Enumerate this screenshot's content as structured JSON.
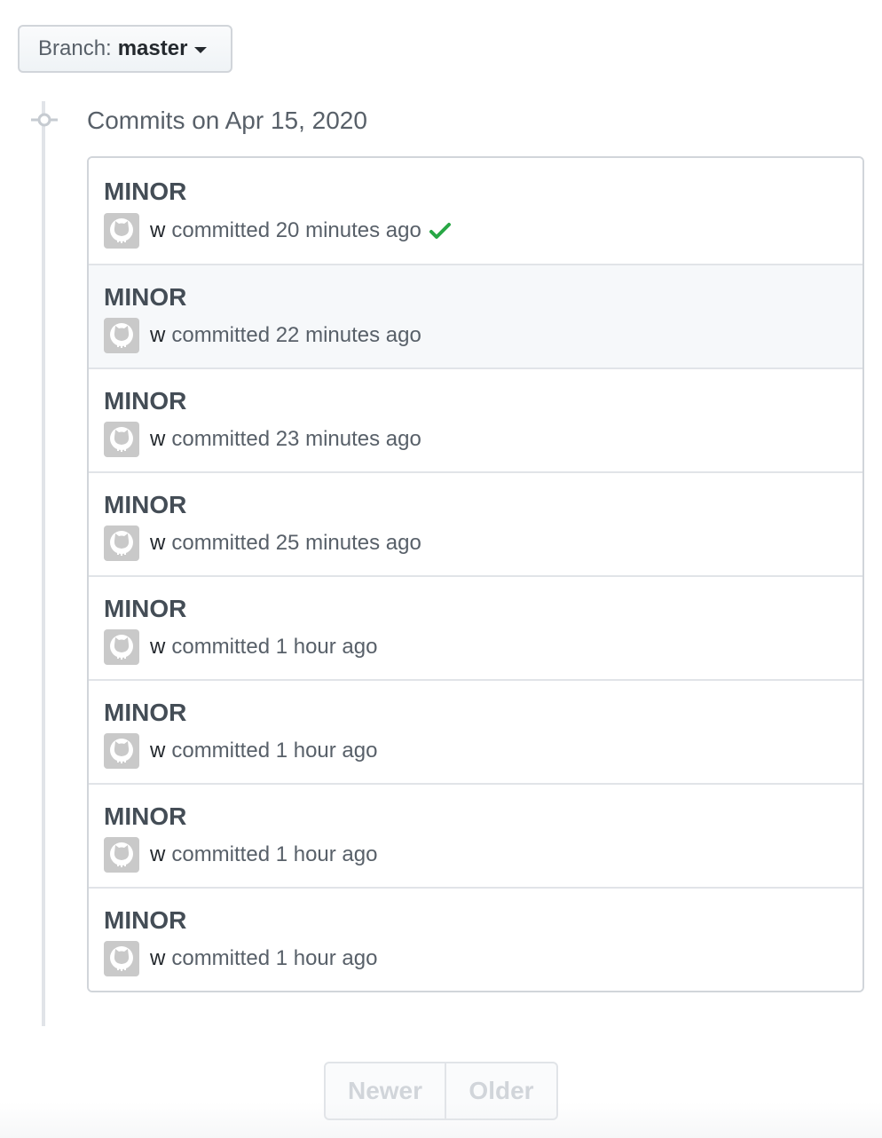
{
  "branch_selector": {
    "prefix": "Branch:",
    "branch": "master"
  },
  "group": {
    "title": "Commits on Apr 15, 2020"
  },
  "commits": [
    {
      "title": "MINOR",
      "author": "w",
      "meta": "committed 20 minutes ago",
      "status": "success"
    },
    {
      "title": "MINOR",
      "author": "w",
      "meta": "committed 22 minutes ago"
    },
    {
      "title": "MINOR",
      "author": "w",
      "meta": "committed 23 minutes ago"
    },
    {
      "title": "MINOR",
      "author": "w",
      "meta": "committed 25 minutes ago"
    },
    {
      "title": "MINOR",
      "author": "w",
      "meta": "committed 1 hour ago"
    },
    {
      "title": "MINOR",
      "author": "w",
      "meta": "committed 1 hour ago"
    },
    {
      "title": "MINOR",
      "author": "w",
      "meta": "committed 1 hour ago"
    },
    {
      "title": "MINOR",
      "author": "w",
      "meta": "committed 1 hour ago"
    }
  ],
  "pagination": {
    "newer_label": "Newer",
    "older_label": "Older"
  },
  "colors": {
    "success": "#28a745",
    "highlight_row": "#f6f8fa",
    "disabled_text": "#d1d5da"
  },
  "icons": {
    "branch_dropdown": "caret-down-icon",
    "timeline_node": "git-commit-icon",
    "avatar": "octocat-avatar-icon",
    "status": "check-icon"
  }
}
